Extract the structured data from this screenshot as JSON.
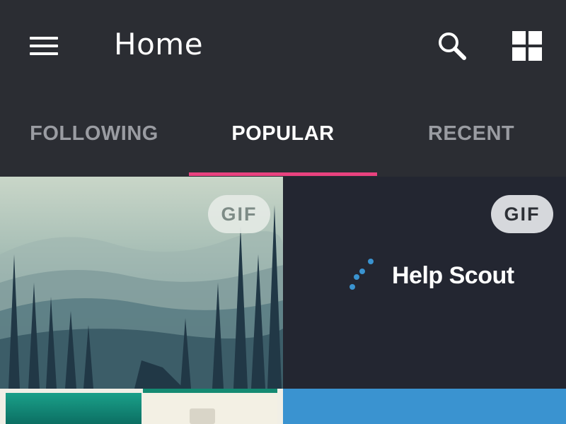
{
  "header": {
    "title": "Home",
    "menu_icon": "hamburger-menu-icon",
    "search_icon": "search-icon",
    "grid_icon": "grid-view-icon"
  },
  "tabs": [
    {
      "label": "FOLLOWING",
      "active": false
    },
    {
      "label": "POPULAR",
      "active": true
    },
    {
      "label": "RECENT",
      "active": false
    }
  ],
  "colors": {
    "background": "#2b2d33",
    "accent": "#e9427f",
    "tab_inactive": "#9a9ca2",
    "tab_active": "#ffffff"
  },
  "feed": {
    "items": [
      {
        "badge": "GIF",
        "kind": "misty-forest-image"
      },
      {
        "badge": "GIF",
        "kind": "help-scout-logo",
        "logo_text": "Help Scout"
      }
    ]
  }
}
